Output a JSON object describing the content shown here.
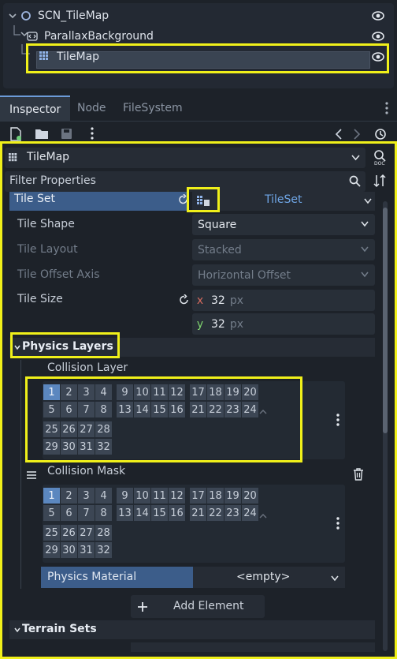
{
  "scene_tree": {
    "root": "SCN_TileMap",
    "child1": "ParallaxBackground",
    "child2": "TileMap"
  },
  "tabs": [
    "Inspector",
    "Node",
    "FileSystem"
  ],
  "inspector": {
    "node_name": "TileMap",
    "filter_placeholder": "Filter Properties",
    "tile_set_label": "Tile Set",
    "tile_set_value": "TileSet",
    "tile_shape_label": "Tile Shape",
    "tile_shape_value": "Square",
    "tile_layout_label": "Tile Layout",
    "tile_layout_value": "Stacked",
    "tile_offset_label": "Tile Offset Axis",
    "tile_offset_value": "Horizontal Offset",
    "tile_size_label": "Tile Size",
    "x_label": "x",
    "x_value": "32",
    "y_label": "y",
    "y_value": "32",
    "unit": "px",
    "physics_layers_label": "Physics Layers",
    "collision_layer_label": "Collision Layer",
    "collision_mask_label": "Collision Mask",
    "physics_material_label": "Physics Material",
    "physics_material_value": "<empty>",
    "add_element_label": "Add Element",
    "terrain_sets_label": "Terrain Sets"
  },
  "layer_grid": {
    "row1": [
      "1",
      "2",
      "3",
      "4",
      "9",
      "10",
      "11",
      "12",
      "17",
      "18",
      "19",
      "20"
    ],
    "row2": [
      "5",
      "6",
      "7",
      "8",
      "13",
      "14",
      "15",
      "16",
      "21",
      "22",
      "23",
      "24"
    ],
    "row3": [
      "25",
      "26",
      "27",
      "28"
    ],
    "row4": [
      "29",
      "30",
      "31",
      "32"
    ]
  },
  "colors": {
    "highlight": "#f0f01a",
    "accent": "#5b87bf",
    "background": "#1d2229"
  }
}
